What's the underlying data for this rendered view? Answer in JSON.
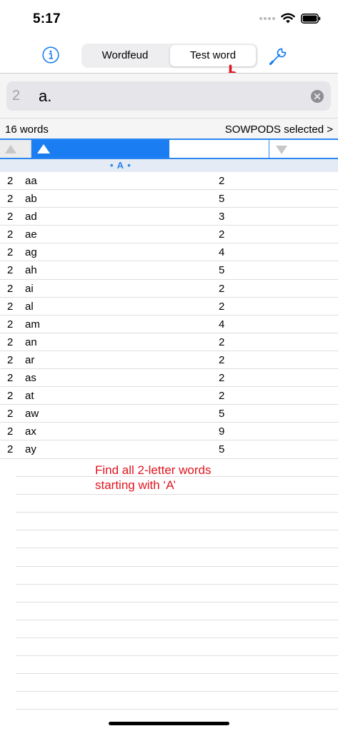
{
  "status_bar": {
    "time": "5:17"
  },
  "toolbar": {
    "segments": [
      "Wordfeud",
      "Test word"
    ],
    "selected_segment": "Test word",
    "accent_color": "#1a7ef2"
  },
  "search": {
    "length_label": "2",
    "pattern": "a."
  },
  "summary": {
    "word_count": "16 words",
    "dictionary": "SOWPODS selected >"
  },
  "section": {
    "label": "• A •"
  },
  "words": [
    {
      "len": "2",
      "word": "aa",
      "score": "2"
    },
    {
      "len": "2",
      "word": "ab",
      "score": "5"
    },
    {
      "len": "2",
      "word": "ad",
      "score": "3"
    },
    {
      "len": "2",
      "word": "ae",
      "score": "2"
    },
    {
      "len": "2",
      "word": "ag",
      "score": "4"
    },
    {
      "len": "2",
      "word": "ah",
      "score": "5"
    },
    {
      "len": "2",
      "word": "ai",
      "score": "2"
    },
    {
      "len": "2",
      "word": "al",
      "score": "2"
    },
    {
      "len": "2",
      "word": "am",
      "score": "4"
    },
    {
      "len": "2",
      "word": "an",
      "score": "2"
    },
    {
      "len": "2",
      "word": "ar",
      "score": "2"
    },
    {
      "len": "2",
      "word": "as",
      "score": "2"
    },
    {
      "len": "2",
      "word": "at",
      "score": "2"
    },
    {
      "len": "2",
      "word": "aw",
      "score": "5"
    },
    {
      "len": "2",
      "word": "ax",
      "score": "9"
    },
    {
      "len": "2",
      "word": "ay",
      "score": "5"
    }
  ],
  "annotation": {
    "line1": "Find all 2-letter words",
    "line2": "starting with ‘A’",
    "color": "#e0141e"
  }
}
